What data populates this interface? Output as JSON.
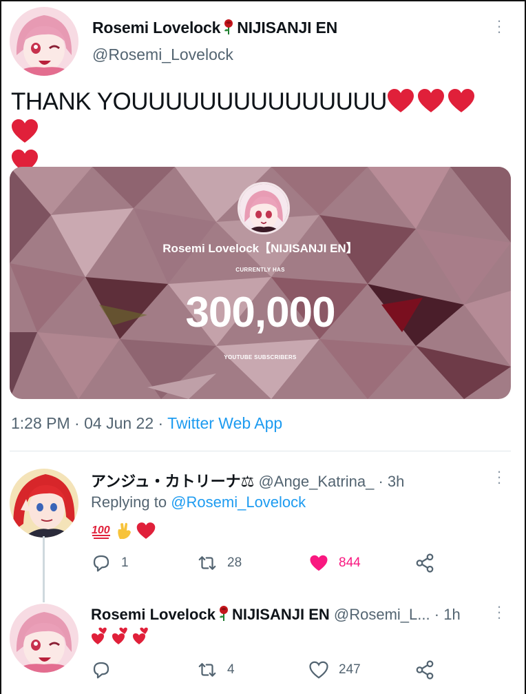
{
  "main_tweet": {
    "display_name_part1": "Rosemi Lovelock",
    "display_name_part2": "NIJISANJI EN",
    "handle": "@Rosemi_Lovelock",
    "text": "THANK YOUUUUUUUUUUUUUUU",
    "heart_count": 5,
    "media": {
      "name": "Rosemi Lovelock【NIJISANJI EN】",
      "top_caption": "CURRENTLY HAS",
      "count": "300,000",
      "bottom_caption": "YOUTUBE SUBSCRIBERS"
    },
    "time": "1:28 PM",
    "date": "04 Jun 22",
    "app": "Twitter Web App"
  },
  "replies": [
    {
      "name": "アンジュ・カトリーナ⚖",
      "handle": "@Ange_Katrina_",
      "time": "3h",
      "replying_label": "Replying to ",
      "replying_to": "@Rosemi_Lovelock",
      "emojis": [
        "hundred-points",
        "crossed-fingers",
        "red-heart"
      ],
      "replies": "1",
      "retweets": "28",
      "likes": "844",
      "liked": true,
      "accent": "#f91880"
    },
    {
      "name_part1": "Rosemi Lovelock",
      "name_part2": "NIJISANJI EN",
      "handle": "@Rosemi_L...",
      "time": "1h",
      "emojis": [
        "heart-exclamation",
        "heart-exclamation",
        "heart-exclamation"
      ],
      "replies": "",
      "retweets": "4",
      "likes": "247",
      "liked": false
    }
  ],
  "colors": {
    "link": "#1d9bf0",
    "secondary_text": "#536471",
    "heart_red": "#e0203a",
    "like_pink": "#f91880"
  },
  "icons": [
    "more-icon",
    "reply-icon",
    "retweet-icon",
    "like-icon",
    "share-icon",
    "rose-icon"
  ]
}
